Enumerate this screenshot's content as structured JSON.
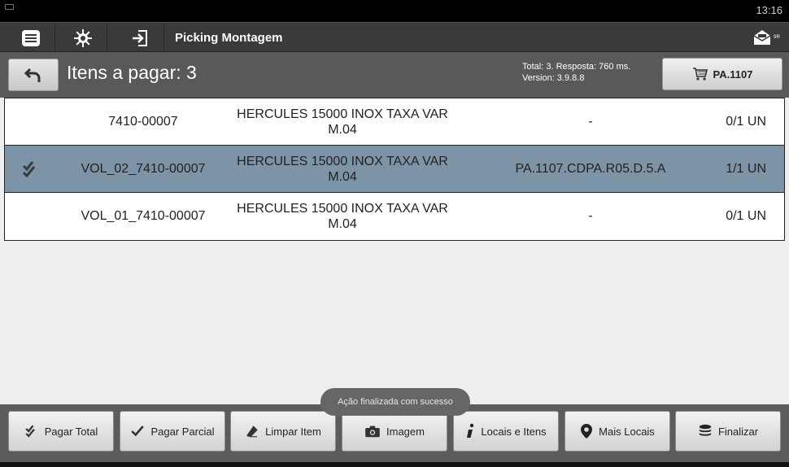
{
  "status_bar": {
    "time": "13:16"
  },
  "action_bar": {
    "title": "Picking Montagem",
    "icons": [
      "menu-icon",
      "settings-gear-icon",
      "login-icon",
      "mail-icon"
    ],
    "mail_badge": "9R"
  },
  "header": {
    "title": "Itens a pagar: 3",
    "info_line1": "Total: 3. Resposta: 760 ms.",
    "info_line2": "Version: 3.9.8.8",
    "location_button": "PA.1107"
  },
  "table": {
    "rows": [
      {
        "code": "7410-00007",
        "desc1": "HERCULES 15000 INOX TAXA VAR",
        "desc2": "M.04",
        "location": "-",
        "qty": "0/1 UN",
        "checked": false
      },
      {
        "code": "VOL_02_7410-00007",
        "desc1": "HERCULES 15000 INOX TAXA VAR",
        "desc2": "M.04",
        "location": "PA.1107.CDPA.R05.D.5.A",
        "qty": "1/1 UN",
        "checked": true
      },
      {
        "code": "VOL_01_7410-00007",
        "desc1": "HERCULES 15000 INOX TAXA VAR",
        "desc2": "M.04",
        "location": "-",
        "qty": "0/1 UN",
        "checked": false
      }
    ]
  },
  "toast": "Ação finalizada com sucesso",
  "toolbar": {
    "pagar_total": "Pagar Total",
    "pagar_parcial": "Pagar Parcial",
    "limpar_item": "Limpar Item",
    "imagem": "Imagem",
    "locais_itens": "Locais e Itens",
    "mais_locais": "Mais Locais",
    "finalizar": "Finalizar"
  },
  "colors": {
    "selected_row": "#7d93a6",
    "header_bg": "#595959",
    "action_bar_bg": "#3a3a3a"
  }
}
